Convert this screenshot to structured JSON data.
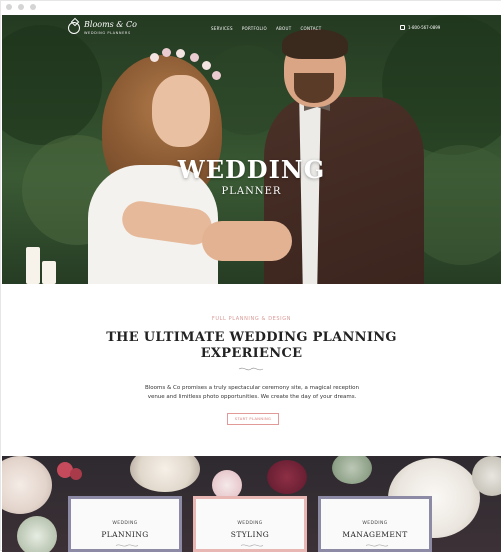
{
  "brand": {
    "name": "Blooms & Co",
    "tagline": "WEDDING PLANNERS"
  },
  "nav": {
    "links": [
      "SERVICES",
      "PORTFOLIO",
      "ABOUT",
      "CONTACT"
    ],
    "phone": "1-800-567-0899"
  },
  "hero": {
    "title": "WEDDING",
    "subtitle": "PLANNER"
  },
  "intro": {
    "eyebrow": "FULL PLANNING & DESIGN",
    "title_line1": "THE ULTIMATE WEDDING PLANNING",
    "title_line2": "EXPERIENCE",
    "body_line1": "Blooms & Co promises a truly spectacular ceremony site, a magical reception",
    "body_line2": "venue and limitless photo opportunities. We create the day of your dreams.",
    "cta": "START PLANNING"
  },
  "services": [
    {
      "kicker": "WEDDING",
      "title": "PLANNING",
      "frame_color": "#8d8aa6"
    },
    {
      "kicker": "WEDDING",
      "title": "STYLING",
      "frame_color": "#e8b6b3"
    },
    {
      "kicker": "WEDDING",
      "title": "MANAGEMENT",
      "frame_color": "#8d8aa6"
    }
  ],
  "colors": {
    "accent": "#d99a97",
    "text": "#222222"
  }
}
